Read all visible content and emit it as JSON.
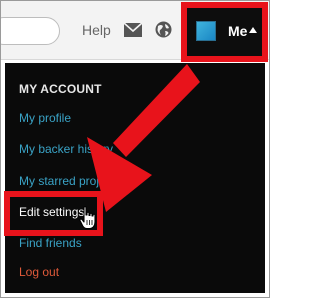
{
  "nav": {
    "help_label": "Help",
    "me_label": "Me"
  },
  "dropdown": {
    "heading": "MY ACCOUNT",
    "items": [
      {
        "label": "My profile"
      },
      {
        "label": "My backer history"
      },
      {
        "label": "My starred projects"
      },
      {
        "label": "Edit settings"
      },
      {
        "label": "Find friends"
      },
      {
        "label": "Log out"
      }
    ]
  },
  "icons": [
    "mail-icon",
    "globe-icon",
    "caret-up-icon",
    "hand-cursor-icon"
  ],
  "colors": {
    "highlight": "#e8131b",
    "menu_bg": "#0a0a0a",
    "link": "#3aa3c6",
    "logout": "#e05a3a",
    "topbar_bg": "#f3f3f3"
  }
}
